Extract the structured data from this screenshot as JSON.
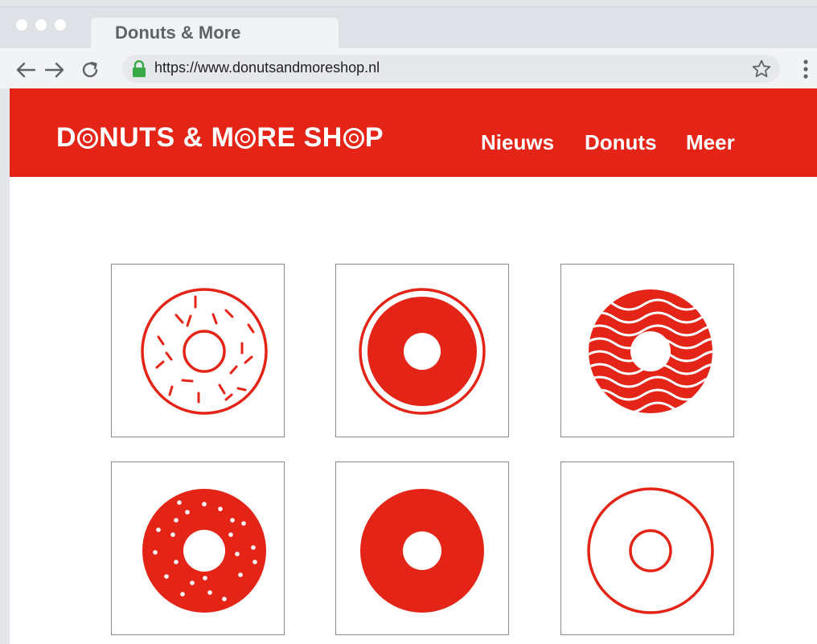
{
  "browser": {
    "tab_title": "Donuts & More",
    "url": "https://www.donutsandmoreshop.nl"
  },
  "site": {
    "logo_parts": [
      "D",
      "NUTS & M",
      "RE SH",
      "P"
    ],
    "nav": [
      "Nieuws",
      "Donuts",
      "Meer"
    ]
  },
  "colors": {
    "brand_red": "#e32417",
    "chrome_gray": "#dee1e5",
    "lock_green": "#3aaa48"
  },
  "products": [
    {
      "icon": "sprinkled-outline-donut-icon"
    },
    {
      "icon": "ringed-solid-donut-icon"
    },
    {
      "icon": "wavy-glazed-donut-icon"
    },
    {
      "icon": "dotted-solid-donut-icon"
    },
    {
      "icon": "plain-solid-donut-icon"
    },
    {
      "icon": "outline-donut-icon"
    }
  ]
}
